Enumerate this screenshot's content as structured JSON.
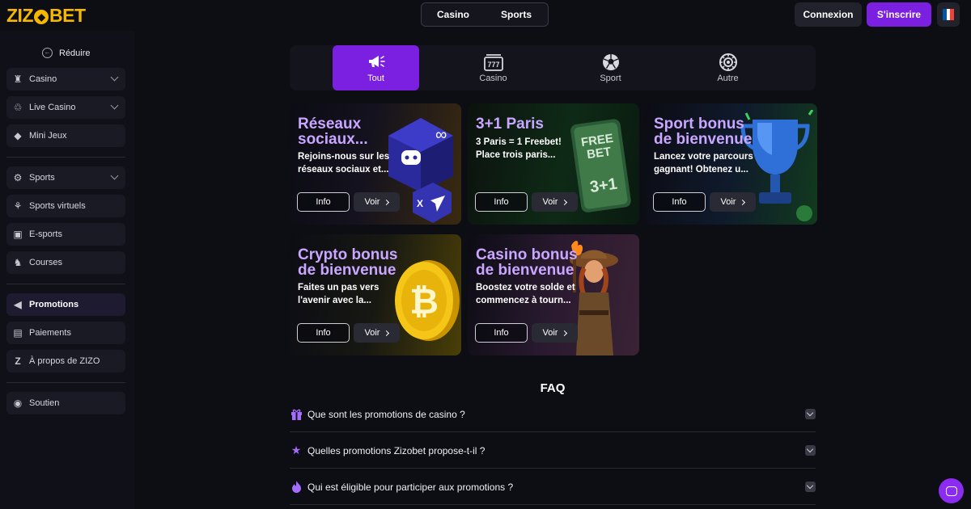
{
  "brand": {
    "logo_pre": "ZIZ",
    "logo_o": "●",
    "logo_post": "BET"
  },
  "topbar": {
    "switch": [
      "Casino",
      "Sports"
    ],
    "login": "Connexion",
    "signup": "S'inscrire",
    "lang_flag_colors": [
      "#0055a4",
      "#ffffff",
      "#ef4135"
    ]
  },
  "sidebar": {
    "collapse": "Réduire",
    "items": [
      {
        "label": "Casino",
        "icon": "casino-icon",
        "glyph": "♜"
      },
      {
        "label": "Live Casino",
        "icon": "live-casino-icon",
        "glyph": "♲"
      },
      {
        "label": "Mini Jeux",
        "icon": "diamond-icon",
        "glyph": "◆"
      },
      {
        "label": "Sports",
        "icon": "ball-icon",
        "glyph": "⚙"
      },
      {
        "label": "Sports virtuels",
        "icon": "virtual-sports-icon",
        "glyph": "⚘"
      },
      {
        "label": "E-sports",
        "icon": "esports-icon",
        "glyph": "▣"
      },
      {
        "label": "Courses",
        "icon": "horse-icon",
        "glyph": "♞"
      },
      {
        "label": "Promotions",
        "icon": "megaphone-icon",
        "glyph": "◀"
      },
      {
        "label": "Paiements",
        "icon": "wallet-icon",
        "glyph": "▤"
      },
      {
        "label": "À propos de ZIZO",
        "icon": "zizo-z-icon",
        "glyph": "Z"
      },
      {
        "label": "Soutien",
        "icon": "headset-icon",
        "glyph": "◉"
      }
    ]
  },
  "tabs": [
    {
      "label": "Tout",
      "icon": "megaphone-icon",
      "glyph": "📣"
    },
    {
      "label": "Casino",
      "icon": "slot-777-icon",
      "glyph": "♛"
    },
    {
      "label": "Sport",
      "icon": "soccer-ball-icon",
      "glyph": "⚽"
    },
    {
      "label": "Autre",
      "icon": "wheel-icon",
      "glyph": "◎"
    }
  ],
  "cards": [
    {
      "title": [
        "Réseaux",
        "sociaux..."
      ],
      "desc": [
        "Rejoins-nous sur les",
        "réseaux sociaux et..."
      ],
      "info": "Info",
      "voir": "Voir",
      "art": "social-dice-art"
    },
    {
      "title": [
        "3+1 Paris"
      ],
      "desc": [
        "3 Paris = 1 Freebet!",
        "Place trois paris..."
      ],
      "info": "Info",
      "voir": "Voir",
      "art": "freebet-card-art",
      "art_text": [
        "FREE",
        "BET",
        "3+1"
      ]
    },
    {
      "title": [
        "Sport bonus",
        "de bienvenue"
      ],
      "desc": [
        "Lancez votre parcours",
        "gagnant! Obtenez u..."
      ],
      "info": "Info",
      "voir": "Voir",
      "art": "trophy-art"
    },
    {
      "title": [
        "Crypto bonus",
        "de bienvenue"
      ],
      "desc": [
        "Faites un pas vers",
        "l'avenir avec la..."
      ],
      "info": "Info",
      "voir": "Voir",
      "art": "bitcoin-coin-art",
      "art_text": [
        "₿"
      ]
    },
    {
      "title": [
        "Casino bonus",
        "de bienvenue"
      ],
      "desc": [
        "Boostez votre solde et",
        "commencez à tourn..."
      ],
      "info": "Info",
      "voir": "Voir",
      "art": "adventurer-art"
    }
  ],
  "faq": {
    "title": "FAQ",
    "items": [
      {
        "q": "Que sont les promotions de casino ?",
        "icon": "gift-icon",
        "glyph": "🎁"
      },
      {
        "q": "Quelles promotions Zizobet propose-t-il ?",
        "icon": "star-icon",
        "glyph": "★"
      },
      {
        "q": "Qui est éligible pour participer aux promotions ?",
        "icon": "flame-icon",
        "glyph": "♨"
      }
    ]
  }
}
